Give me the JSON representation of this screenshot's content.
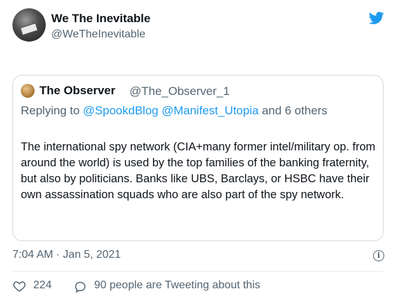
{
  "tweet": {
    "author_name": "We The Inevitable",
    "author_handle": "@WeTheInevitable",
    "quoted": {
      "name": "The Observer",
      "handle": "@The_Observer_1",
      "replying_prefix": "Replying to",
      "replying_mentions": "@SpookdBlog @Manifest_Utopia",
      "replying_suffix": "and 6 others",
      "text": "The international spy network (CIA+many former intel/military op. from around the world) is used by the top families of the banking fraternity, but also by politicians. Banks like UBS, Barclays, or HSBC have their own assassination squads who are also part of the spy network."
    },
    "timestamp": "7:04 AM · Jan 5, 2021",
    "likes": "224",
    "tweeting_text": "90 people are Tweeting about this"
  },
  "icons": {
    "bird": "twitter-bird-icon",
    "info": "info-icon",
    "heart": "heart-icon",
    "bubble": "comment-bubble-icon"
  },
  "colors": {
    "accent": "#1d9bf0",
    "text": "#0f1419",
    "muted": "#536471",
    "border": "#cfd9de"
  }
}
